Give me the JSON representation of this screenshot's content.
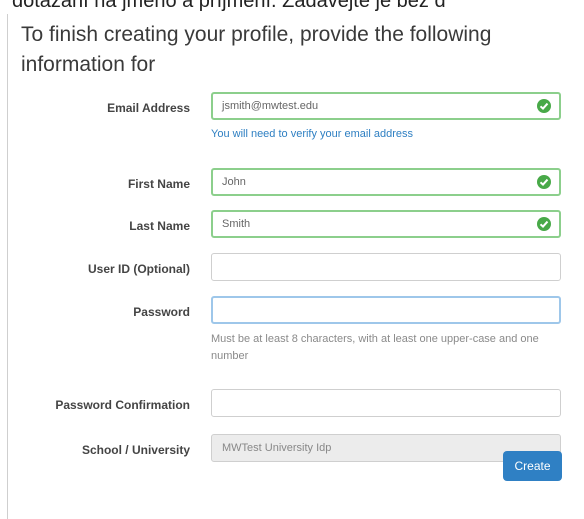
{
  "top_clip": "dotazání na jméno a příjmení. Zadávejte je bez d",
  "heading": "To finish creating your profile, provide the following information for",
  "fields": {
    "email": {
      "label": "Email Address",
      "value": "jsmith@mwtest.edu",
      "help": "You will need to verify your email address"
    },
    "first": {
      "label": "First Name",
      "value": "John"
    },
    "last": {
      "label": "Last Name",
      "value": "Smith"
    },
    "userid": {
      "label": "User ID (Optional)",
      "value": ""
    },
    "password": {
      "label": "Password",
      "value": "",
      "help": "Must be at least 8 characters, with at least one upper-case and one number"
    },
    "confirm": {
      "label": "Password Confirmation",
      "value": ""
    },
    "school": {
      "label": "School / University",
      "value": "MWTest University Idp"
    }
  },
  "button": {
    "label": "Create"
  },
  "colors": {
    "valid_border": "#8ccf8c",
    "check": "#48a948",
    "focus_border": "#9ec7ea",
    "link": "#2e7fc2",
    "button": "#2f80c4"
  },
  "icons": {
    "valid": "check-circle-icon"
  }
}
